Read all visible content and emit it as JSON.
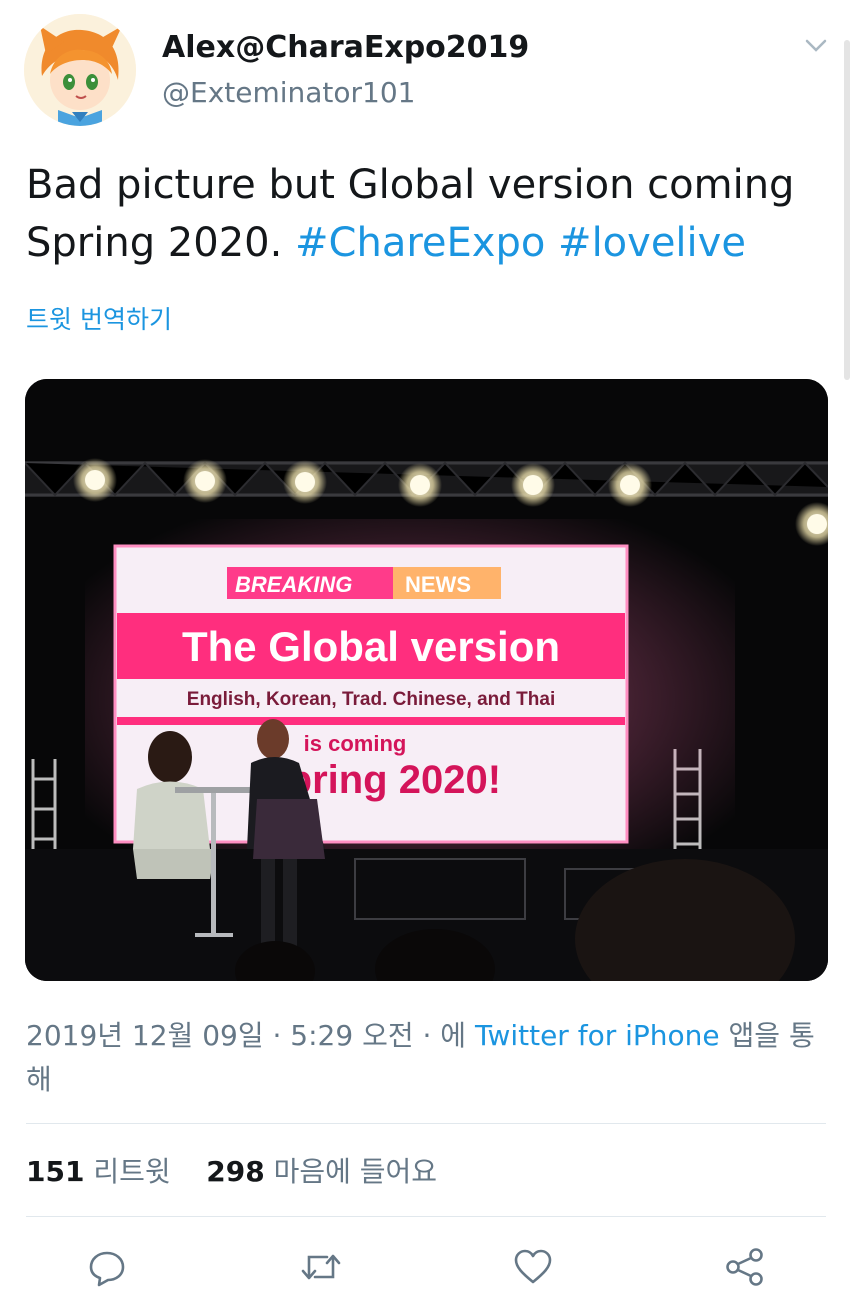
{
  "tweet": {
    "display_name": "Alex@CharaExpo2019",
    "handle": "@Exteminator101",
    "text_plain": "Bad picture but Global version coming Spring 2020.",
    "hashtag_1": "#ChareExpo",
    "hashtag_2": "#lovelive",
    "translate_label": "트윗 번역하기",
    "timestamp": "2019년 12월 09일 · 5:29 오전 · 에",
    "via_app": "Twitter for iPhone",
    "via_suffix": "앱을 통해",
    "retweet_count": "151",
    "retweet_label": "리트윗",
    "like_count": "298",
    "like_label": "마음에 들어요"
  },
  "media": {
    "screen_tag_1": "BREAKING",
    "screen_tag_2": "NEWS",
    "screen_headline": "The Global version",
    "screen_languages": "English, Korean, Trad. Chinese, and Thai",
    "screen_is_coming": "is coming",
    "screen_date": "Spring 2020!"
  },
  "icons": {
    "reply": "reply-icon",
    "retweet": "retweet-icon",
    "like": "heart-icon",
    "share": "share-icon",
    "menu": "chevron-down-icon"
  },
  "colors": {
    "link": "#1b95e0",
    "secondary_text": "#657786",
    "primary_text": "#14171a",
    "screen_pink": "#ff2e7e"
  }
}
